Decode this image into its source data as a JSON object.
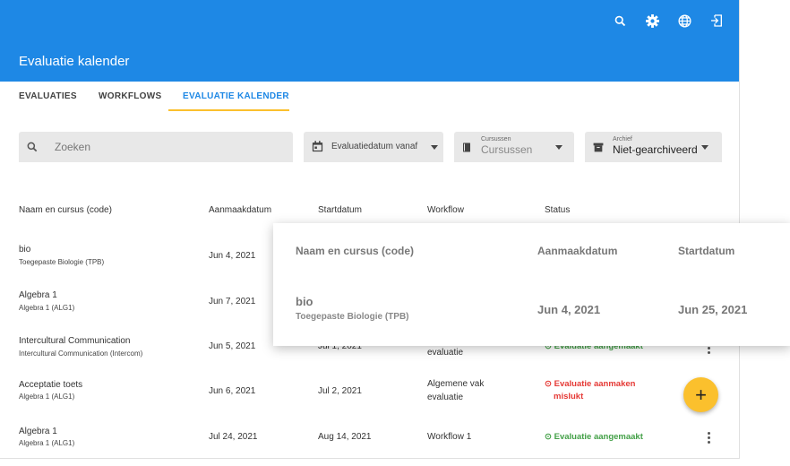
{
  "header": {
    "title": "Evaluatie kalender",
    "icons": [
      "search-icon",
      "settings-icon",
      "globe-icon",
      "logout-icon"
    ]
  },
  "tabs": [
    {
      "label": "EVALUATIES",
      "active": false
    },
    {
      "label": "WORKFLOWS",
      "active": false
    },
    {
      "label": "EVALUATIE KALENDER",
      "active": true
    }
  ],
  "filters": {
    "search_placeholder": "Zoeken",
    "date_label": "Evaluatiedatum vanaf",
    "courses_small": "Cursussen",
    "courses_value": "Cursussen",
    "archive_small": "Archief",
    "archive_value": "Niet-gearchiveerd"
  },
  "table": {
    "headers": [
      "Naam en cursus (code)",
      "Aanmaakdatum",
      "Startdatum",
      "Workflow",
      "Status"
    ],
    "rows": [
      {
        "name": "bio",
        "course": "Toegepaste Biologie (TPB)",
        "created": "Jun 4, 2021",
        "start": "",
        "workflow": "",
        "status": ""
      },
      {
        "name": "Algebra 1",
        "course": "Algebra 1 (ALG1)",
        "created": "Jun 7, 2021",
        "start": "",
        "workflow": "",
        "status": ""
      },
      {
        "name": "Intercultural Communication",
        "course": "Intercultural Communication (Intercom)",
        "created": "Jun 5, 2021",
        "start": "Jul 1, 2021",
        "workflow": "evaluatie",
        "status": "Evaluatie aangemaakt"
      },
      {
        "name": "Acceptatie toets",
        "course": "Algebra 1 (ALG1)",
        "created": "Jun 6, 2021",
        "start": "Jul 2, 2021",
        "workflow1": "Algemene vak",
        "workflow2": "evaluatie",
        "status1": "Evaluatie aanmaken",
        "status2": "mislukt"
      },
      {
        "name": "Algebra 1",
        "course": "Algebra 1 (ALG1)",
        "created": "Jul 24, 2021",
        "start": "Aug 14, 2021",
        "workflow": "Workflow 1",
        "status": "Evaluatie aangemaakt"
      }
    ]
  },
  "zoom": {
    "headers": [
      "Naam en cursus (code)",
      "Aanmaakdatum",
      "Startdatum"
    ],
    "name": "bio",
    "course": "Toegepaste Biologie (TPB)",
    "created": "Jun 4, 2021",
    "start": "Jun 25, 2021"
  },
  "fab_label": "+",
  "colors": {
    "primary": "#1e88e5",
    "accent": "#fbc02d",
    "success": "#43a047",
    "error": "#e53935"
  }
}
